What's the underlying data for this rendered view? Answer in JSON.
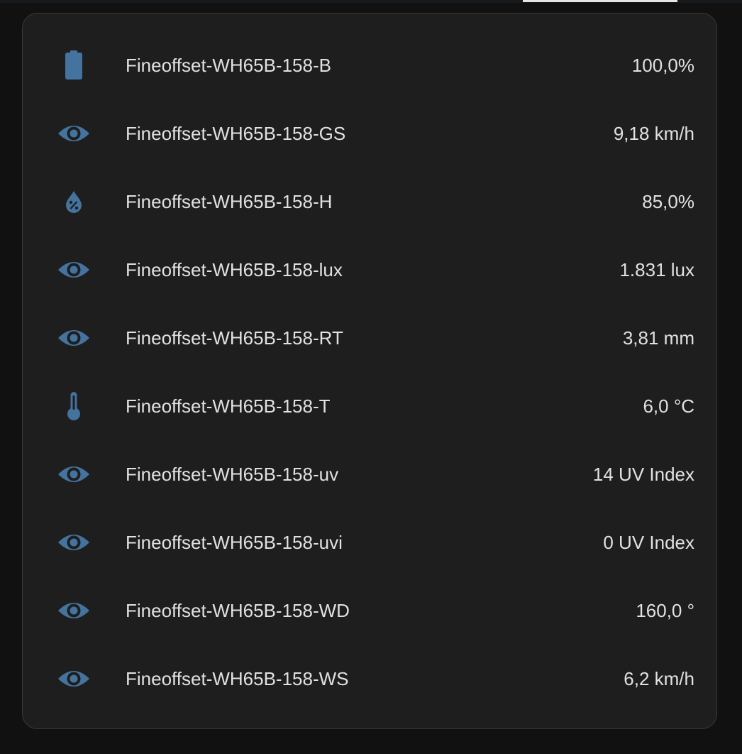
{
  "icon_color": "#44739e",
  "entities": [
    {
      "icon": "battery-icon",
      "name": "Fineoffset-WH65B-158-B",
      "value": "100,0%"
    },
    {
      "icon": "eye-icon",
      "name": "Fineoffset-WH65B-158-GS",
      "value": "9,18 km/h"
    },
    {
      "icon": "water-percent-icon",
      "name": "Fineoffset-WH65B-158-H",
      "value": "85,0%"
    },
    {
      "icon": "eye-icon",
      "name": "Fineoffset-WH65B-158-lux",
      "value": "1.831 lux"
    },
    {
      "icon": "eye-icon",
      "name": "Fineoffset-WH65B-158-RT",
      "value": "3,81 mm"
    },
    {
      "icon": "thermometer-icon",
      "name": "Fineoffset-WH65B-158-T",
      "value": "6,0 °C"
    },
    {
      "icon": "eye-icon",
      "name": "Fineoffset-WH65B-158-uv",
      "value": "14 UV Index"
    },
    {
      "icon": "eye-icon",
      "name": "Fineoffset-WH65B-158-uvi",
      "value": "0 UV Index"
    },
    {
      "icon": "eye-icon",
      "name": "Fineoffset-WH65B-158-WD",
      "value": "160,0 °"
    },
    {
      "icon": "eye-icon",
      "name": "Fineoffset-WH65B-158-WS",
      "value": "6,2 km/h"
    }
  ]
}
